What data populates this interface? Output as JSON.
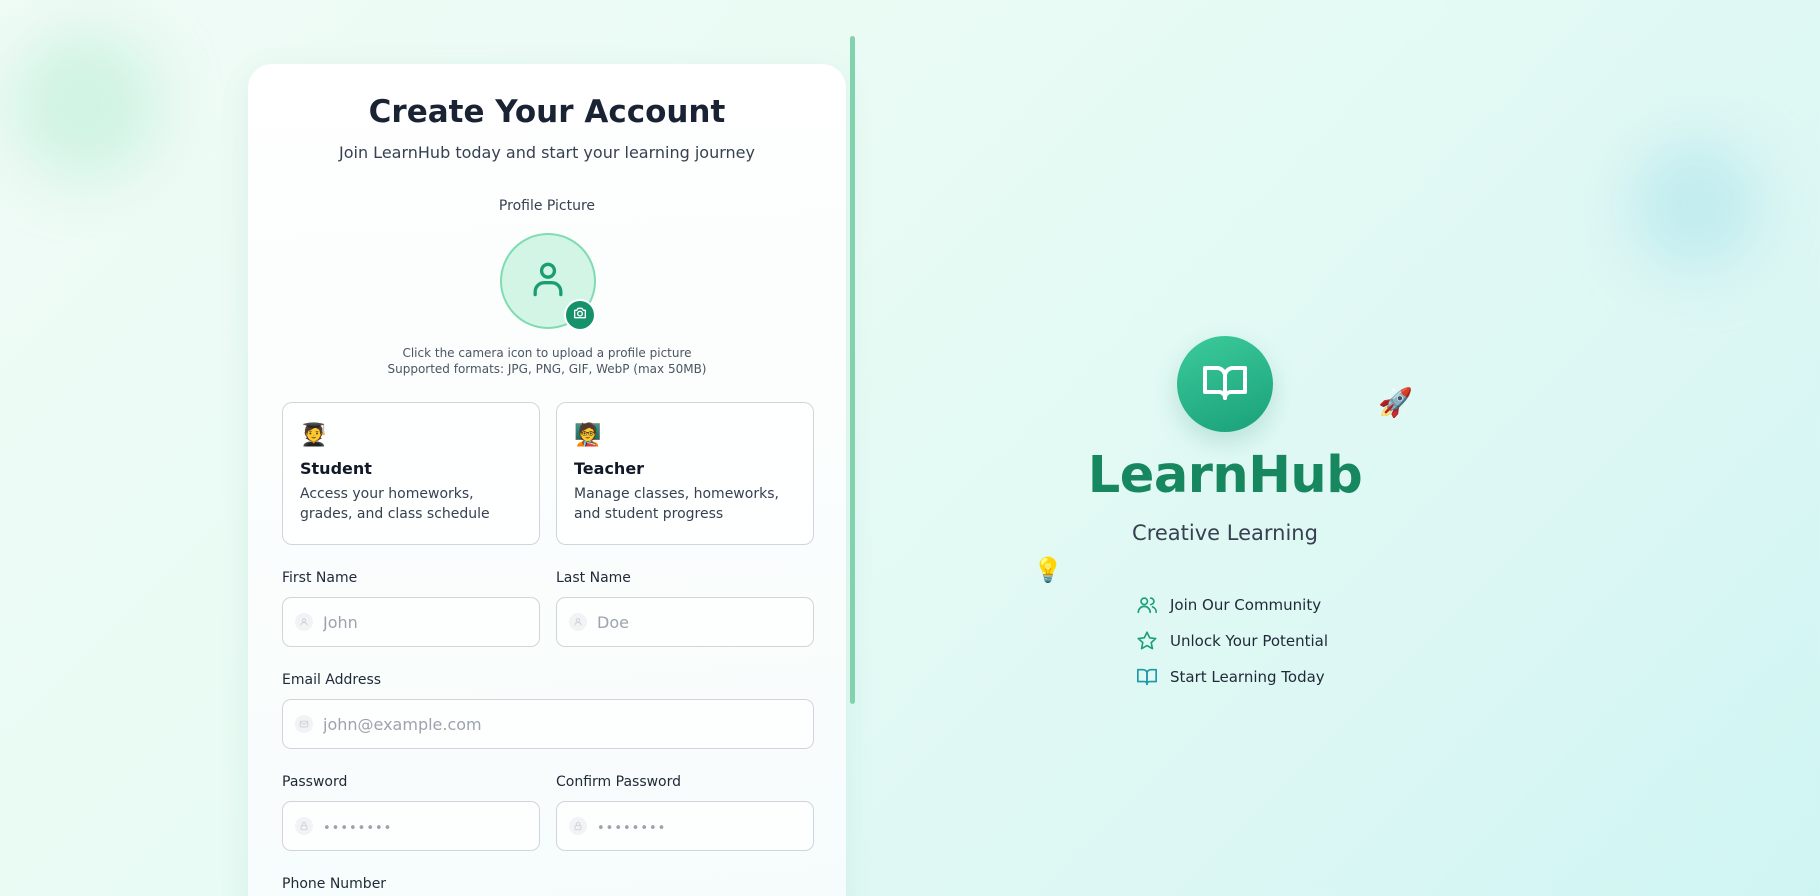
{
  "form": {
    "title": "Create Your Account",
    "subtitle": "Join LearnHub today and start your learning journey",
    "profile_picture_label": "Profile Picture",
    "upload_hint_line1": "Click the camera icon to upload a profile picture",
    "upload_hint_line2": "Supported formats: JPG, PNG, GIF, WebP (max 50MB)",
    "roles": [
      {
        "emoji": "🧑‍🎓",
        "title": "Student",
        "description": "Access your homeworks, grades, and class schedule"
      },
      {
        "emoji": "🧑‍🏫",
        "title": "Teacher",
        "description": "Manage classes, homeworks, and student progress"
      }
    ],
    "fields": {
      "first_name": {
        "label": "First Name",
        "placeholder": "John",
        "value": ""
      },
      "last_name": {
        "label": "Last Name",
        "placeholder": "Doe",
        "value": ""
      },
      "email": {
        "label": "Email Address",
        "placeholder": "john@example.com",
        "value": ""
      },
      "password": {
        "label": "Password",
        "placeholder": "••••••••",
        "value": ""
      },
      "confirm_password": {
        "label": "Confirm Password",
        "placeholder": "••••••••",
        "value": ""
      },
      "phone": {
        "label": "Phone Number"
      }
    }
  },
  "brand": {
    "name": "LearnHub",
    "tagline": "Creative Learning",
    "features": [
      {
        "icon": "users-icon",
        "label": "Join Our Community"
      },
      {
        "icon": "star-icon",
        "label": "Unlock Your Potential"
      },
      {
        "icon": "book-icon",
        "label": "Start Learning Today"
      }
    ],
    "decorations": {
      "rocket": "🚀",
      "bulb": "💡"
    }
  },
  "colors": {
    "accent": "#17875f",
    "accent_light": "#3ccb9a",
    "avatar_bg": "#d3f5e6",
    "scrollbar": "#82d3ad"
  }
}
